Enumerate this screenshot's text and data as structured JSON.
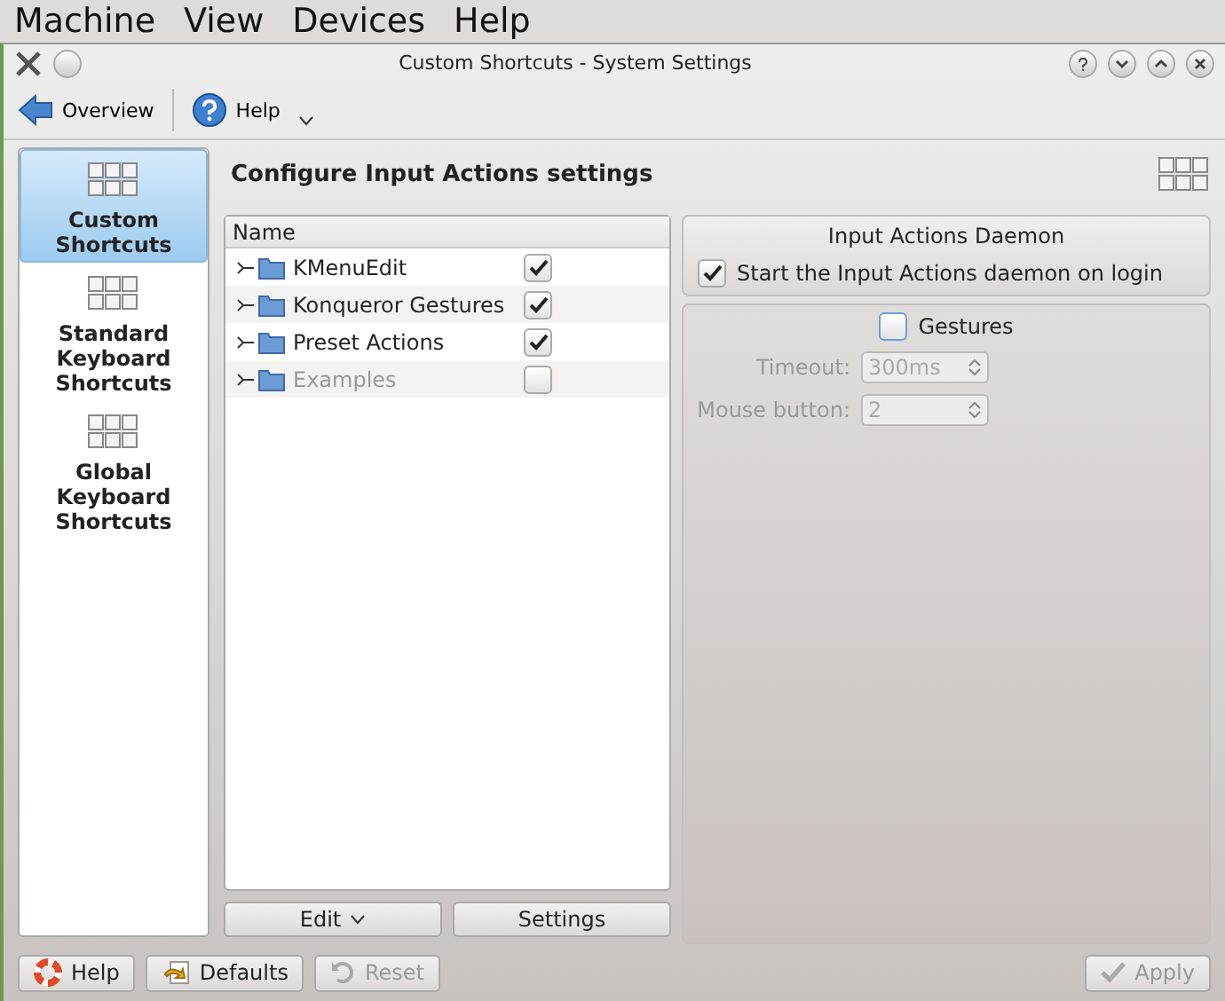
{
  "menu_bar": [
    "Machine",
    "View",
    "Devices",
    "Help"
  ],
  "window": {
    "title": "Custom Shortcuts - System Settings"
  },
  "toolbar": [
    {
      "label": "Overview",
      "kind": "back"
    },
    {
      "label": "Help",
      "kind": "help"
    }
  ],
  "sidebar": {
    "items": [
      {
        "label": "Custom Shortcuts",
        "selected": true
      },
      {
        "label": "Standard Keyboard Shortcuts",
        "selected": false
      },
      {
        "label": "Global Keyboard Shortcuts",
        "selected": false
      }
    ]
  },
  "heading": "Configure Input Actions settings",
  "tree": {
    "columns": [
      "Name"
    ],
    "rows": [
      {
        "label": "KMenuEdit",
        "checked": true,
        "disabled": false,
        "expanded": false
      },
      {
        "label": "Konqueror Gestures",
        "checked": true,
        "disabled": false,
        "expanded": false
      },
      {
        "label": "Preset Actions",
        "checked": true,
        "disabled": false,
        "expanded": false
      },
      {
        "label": "Examples",
        "checked": false,
        "disabled": true,
        "expanded": false
      }
    ]
  },
  "tree_buttons": [
    {
      "label": "Edit",
      "kind": "menu"
    },
    {
      "label": "Settings",
      "kind": "plain"
    }
  ],
  "daemon": {
    "title": "Input Actions Daemon",
    "option": {
      "label": "Start the Input Actions daemon on login",
      "checked": true
    }
  },
  "gestures": {
    "label": "Gestures",
    "checked": false,
    "fields": [
      {
        "label": "Timeout:",
        "value": "300ms",
        "disabled": true
      },
      {
        "label": "Mouse button:",
        "value": "2",
        "disabled": true
      }
    ]
  },
  "bottom_buttons": [
    {
      "label": "Help",
      "kind": "help",
      "disabled": false
    },
    {
      "label": "Defaults",
      "kind": "defaults",
      "disabled": false
    },
    {
      "label": "Reset",
      "kind": "reset",
      "disabled": true
    },
    {
      "label": "Apply",
      "kind": "apply",
      "disabled": true
    }
  ]
}
